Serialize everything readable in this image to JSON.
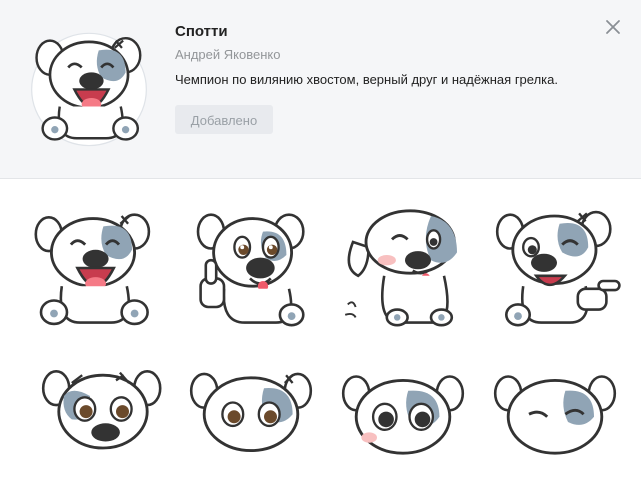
{
  "pack": {
    "title": "Спотти",
    "author": "Андрей Яковенко",
    "description": "Чемпион по вилянию хвостом, верный друг и надёжная грелка.",
    "button_label": "Добавлено"
  },
  "icons": {
    "close": "close-icon"
  },
  "colors": {
    "header_bg": "#f5f6f8",
    "body_bg": "#ffffff",
    "spot": "#90a4b5",
    "nose": "#333333",
    "tongue": "#f05a6a",
    "button_bg": "#e8eaee",
    "button_text": "#9aa0a6"
  },
  "stickers": [
    {
      "name": "laughing"
    },
    {
      "name": "thumbs-up"
    },
    {
      "name": "sitting-wink"
    },
    {
      "name": "winking-point"
    },
    {
      "name": "surprised-1"
    },
    {
      "name": "surprised-2"
    },
    {
      "name": "scared"
    },
    {
      "name": "smirk"
    }
  ]
}
